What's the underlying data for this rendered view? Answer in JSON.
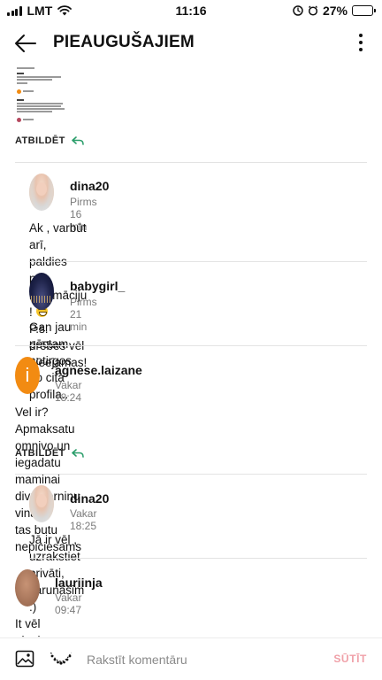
{
  "status_bar": {
    "carrier": "LMT",
    "time": "11:16",
    "battery": "27%",
    "battery_level": 0.27
  },
  "header": {
    "title": "PIEAUGUŠAJIEM"
  },
  "reply_label": "ATBILDĒT",
  "comments": [
    {
      "username": "dina20",
      "time": "Pirms 16 min",
      "text_line1": "Ak , varbūt arī, paldies par informāciju !",
      "text_line2": "P.s. drēbes vēl pieejamas!"
    },
    {
      "username": "babygirl_",
      "time": "Pirms 21 min",
      "text": "Gan jau pēctam notirgos no cita profila.."
    },
    {
      "username": "agnese.laizane",
      "avatar_letter": "i",
      "time": "Vakar 18:24",
      "text_line1": "Vel ir? Apmaksatu omnivo un iegadatu maminai divu berninu vinai",
      "text_line2": "tas butu nepiciesams"
    },
    {
      "username": "dina20",
      "time": "Vakar 18:25",
      "text": "Jā ir vēl , uzrakstiet privāti, sarunāsim :)"
    },
    {
      "username": "lauriinja",
      "time": "Vakar 09:47",
      "text": "It vēl pieejams"
    }
  ],
  "composer": {
    "placeholder": "Rakstīt komentāru",
    "send_label": "SŪTĪT"
  },
  "colors": {
    "accent_green": "#2a9d6a",
    "send_disabled": "#f0a0a8",
    "avatar_orange": "#f28b12"
  }
}
